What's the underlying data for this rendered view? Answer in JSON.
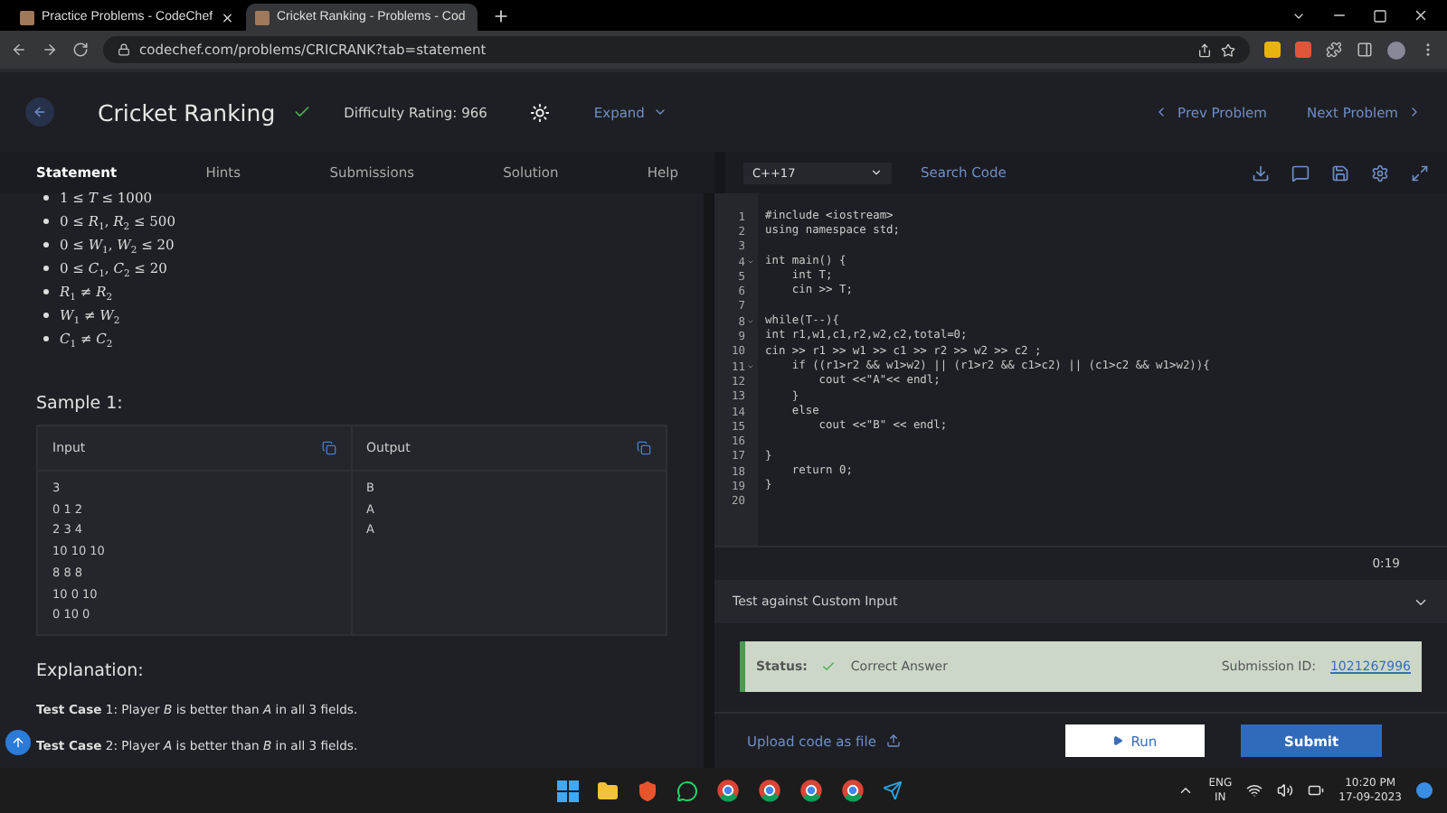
{
  "browser": {
    "tabs": [
      {
        "title": "Practice Problems - CodeChef",
        "selected": false
      },
      {
        "title": "Cricket Ranking - Problems - Cod",
        "selected": true
      }
    ],
    "url": "codechef.com/problems/CRICRANK?tab=statement"
  },
  "header": {
    "title": "Cricket Ranking",
    "solved": true,
    "difficulty": "Difficulty Rating: 966",
    "expand": "Expand",
    "prev": "Prev Problem",
    "next": "Next Problem"
  },
  "tabs": [
    {
      "label": "Statement",
      "selected": true
    },
    {
      "label": "Hints",
      "selected": false
    },
    {
      "label": "Submissions",
      "selected": false
    },
    {
      "label": "Solution",
      "selected": false
    },
    {
      "label": "Help",
      "selected": false
    }
  ],
  "constraints": [
    "1 ≤ *T* ≤ 1000",
    "0 ≤ *R*$_{1}$, *R*$_{2}$ ≤ 500",
    "0 ≤ *W*$_{1}$, *W*$_{2}$ ≤ 20",
    "0 ≤ *C*$_{1}$, *C*$_{2}$ ≤ 20",
    "*R*$_{1}$ ≠ *R*$_{2}$",
    "*W*$_{1}$ ≠ *W*$_{2}$",
    "*C*$_{1}$ ≠ *C*$_{2}$"
  ],
  "sample": {
    "title": "Sample 1:",
    "input_label": "Input",
    "output_label": "Output",
    "input_lines": [
      "3",
      "0 1 2",
      "2 3 4",
      "10 10 10",
      "8 8 8",
      "10 0 10",
      "0 10 0"
    ],
    "output_lines": [
      "B",
      "A",
      "A"
    ]
  },
  "explanation": {
    "title": "Explanation:",
    "lines": [
      "**Test Case** 1: Player *B* is better than *A* in all 3 fields.",
      "**Test Case** 2: Player *A* is better than *B* in all 3 fields."
    ]
  },
  "editor": {
    "language": "C++17",
    "search": "Search Code",
    "timer": "0:19",
    "lines": [
      {
        "n": "1",
        "text": "#include <iostream>",
        "fold": false
      },
      {
        "n": "2",
        "text": "using namespace std;",
        "fold": false
      },
      {
        "n": "3",
        "fold": false
      },
      {
        "n": "4",
        "text": "int main() {",
        "fold": true
      },
      {
        "n": "5",
        "text": "    int T;",
        "fold": false
      },
      {
        "n": "6",
        "text": "    cin >> T;",
        "fold": false
      },
      {
        "n": "7",
        "fold": false
      },
      {
        "n": "8",
        "text": "while(T--){",
        "fold": true
      },
      {
        "n": "9",
        "text": "int r1,w1,c1,r2,w2,c2,total=0;",
        "fold": false
      },
      {
        "n": "10",
        "text": "cin >> r1 >> w1 >> c1 >> r2 >> w2 >> c2 ;",
        "fold": false
      },
      {
        "n": "11",
        "text": "    if ((r1>r2 && w1>w2) || (r1>r2 && c1>c2) || (c1>c2 && w1>w2)){",
        "fold": true
      },
      {
        "n": "12",
        "text": "        cout <<\"A\"<< endl;",
        "fold": false
      },
      {
        "n": "13",
        "text": "    }",
        "fold": false
      },
      {
        "n": "14",
        "text": "    else",
        "fold": false
      },
      {
        "n": "15",
        "text": "        cout <<\"B\" << endl;",
        "fold": false
      },
      {
        "n": "16",
        "fold": false
      },
      {
        "n": "17",
        "text": "}",
        "fold": false
      },
      {
        "n": "18",
        "text": "    return 0;",
        "fold": false
      },
      {
        "n": "19",
        "text": "}",
        "fold": false
      },
      {
        "n": "20",
        "fold": false
      }
    ]
  },
  "custom_input": {
    "label": "Test against Custom Input",
    "expanded": false
  },
  "status": {
    "label": "Status:",
    "result": "Correct Answer",
    "id_label": "Submission ID:",
    "id": "1021267996"
  },
  "actions": {
    "upload": "Upload code as file",
    "run": "Run",
    "submit": "Submit"
  },
  "taskbar": {
    "language": "ENG",
    "region": "IN",
    "time": "10:20 PM",
    "date": "17-09-2023"
  }
}
